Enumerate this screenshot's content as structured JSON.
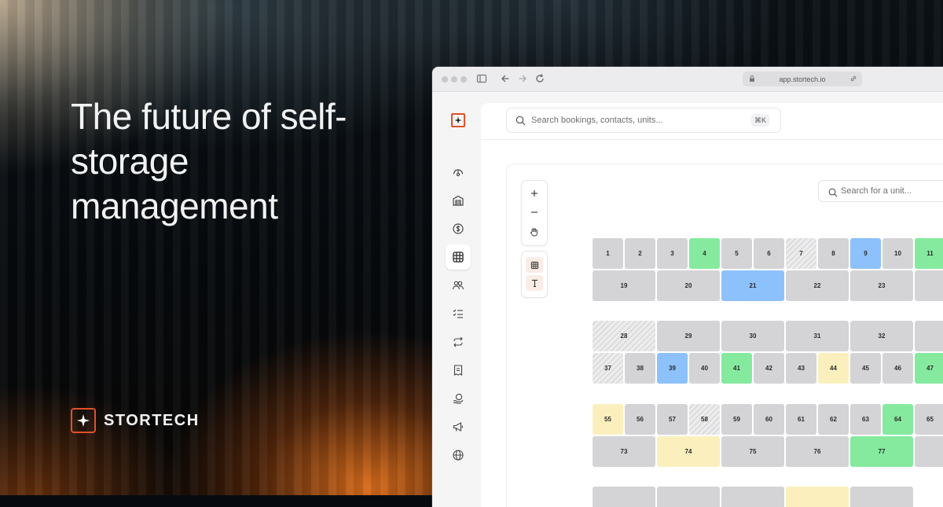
{
  "hero": {
    "headline": "The future of self-storage management",
    "brand_name": "STORTECH"
  },
  "browser": {
    "url": "app.stortech.io"
  },
  "app": {
    "search": {
      "placeholder": "Search bookings, contacts, units...",
      "shortcut": "⌘K"
    },
    "sidebar": {
      "items": [
        {
          "icon": "dashboard-gauge-icon"
        },
        {
          "icon": "facility-warehouse-icon"
        },
        {
          "icon": "billing-dollar-icon"
        },
        {
          "icon": "unit-map-grid-icon",
          "active": true
        },
        {
          "icon": "contacts-people-icon"
        },
        {
          "icon": "tasks-checklist-icon"
        },
        {
          "icon": "recurring-refresh-icon"
        },
        {
          "icon": "reports-receipt-icon"
        },
        {
          "icon": "payments-coins-icon"
        },
        {
          "icon": "marketing-megaphone-icon"
        },
        {
          "icon": "website-globe-icon"
        }
      ]
    },
    "map": {
      "unit_search_placeholder": "Search for a unit...",
      "tools": [
        "zoom-in",
        "zoom-out",
        "pan-hand",
        "grid-layer",
        "text-layer"
      ],
      "status_colors": {
        "available": "#d4d4d6",
        "occupied": "#85ea9e",
        "reserved": "#8cc1fb",
        "pending": "#fbf0bd",
        "unavailable": "hatched-grey"
      },
      "units": [
        {
          "label": "1",
          "status": "available"
        },
        {
          "label": "2",
          "status": "available"
        },
        {
          "label": "3",
          "status": "available"
        },
        {
          "label": "4",
          "status": "occupied"
        },
        {
          "label": "5",
          "status": "available"
        },
        {
          "label": "6",
          "status": "available"
        },
        {
          "label": "7",
          "status": "unavailable"
        },
        {
          "label": "8",
          "status": "available"
        },
        {
          "label": "9",
          "status": "reserved"
        },
        {
          "label": "10",
          "status": "available"
        },
        {
          "label": "11",
          "status": "occupied"
        },
        {
          "label": "19",
          "status": "available"
        },
        {
          "label": "20",
          "status": "available"
        },
        {
          "label": "21",
          "status": "reserved"
        },
        {
          "label": "22",
          "status": "available"
        },
        {
          "label": "23",
          "status": "available"
        },
        {
          "label": "",
          "status": "available"
        },
        {
          "label": "28",
          "status": "unavailable"
        },
        {
          "label": "29",
          "status": "available"
        },
        {
          "label": "30",
          "status": "available"
        },
        {
          "label": "31",
          "status": "available"
        },
        {
          "label": "32",
          "status": "available"
        },
        {
          "label": "",
          "status": "available"
        },
        {
          "label": "37",
          "status": "unavailable"
        },
        {
          "label": "38",
          "status": "available"
        },
        {
          "label": "39",
          "status": "reserved"
        },
        {
          "label": "40",
          "status": "available"
        },
        {
          "label": "41",
          "status": "occupied"
        },
        {
          "label": "42",
          "status": "available"
        },
        {
          "label": "43",
          "status": "available"
        },
        {
          "label": "44",
          "status": "pending"
        },
        {
          "label": "45",
          "status": "available"
        },
        {
          "label": "46",
          "status": "available"
        },
        {
          "label": "47",
          "status": "occupied"
        },
        {
          "label": "55",
          "status": "pending"
        },
        {
          "label": "56",
          "status": "available"
        },
        {
          "label": "57",
          "status": "available"
        },
        {
          "label": "58",
          "status": "unavailable"
        },
        {
          "label": "59",
          "status": "available"
        },
        {
          "label": "60",
          "status": "available"
        },
        {
          "label": "61",
          "status": "available"
        },
        {
          "label": "62",
          "status": "available"
        },
        {
          "label": "63",
          "status": "available"
        },
        {
          "label": "64",
          "status": "occupied"
        },
        {
          "label": "65",
          "status": "available"
        },
        {
          "label": "73",
          "status": "available"
        },
        {
          "label": "74",
          "status": "pending"
        },
        {
          "label": "75",
          "status": "available"
        },
        {
          "label": "76",
          "status": "available"
        },
        {
          "label": "77",
          "status": "occupied"
        },
        {
          "label": "",
          "status": "available"
        },
        {
          "label": "",
          "status": "available"
        },
        {
          "label": "",
          "status": "available"
        },
        {
          "label": "",
          "status": "available"
        },
        {
          "label": "",
          "status": "pending"
        },
        {
          "label": "",
          "status": "available"
        }
      ]
    }
  }
}
